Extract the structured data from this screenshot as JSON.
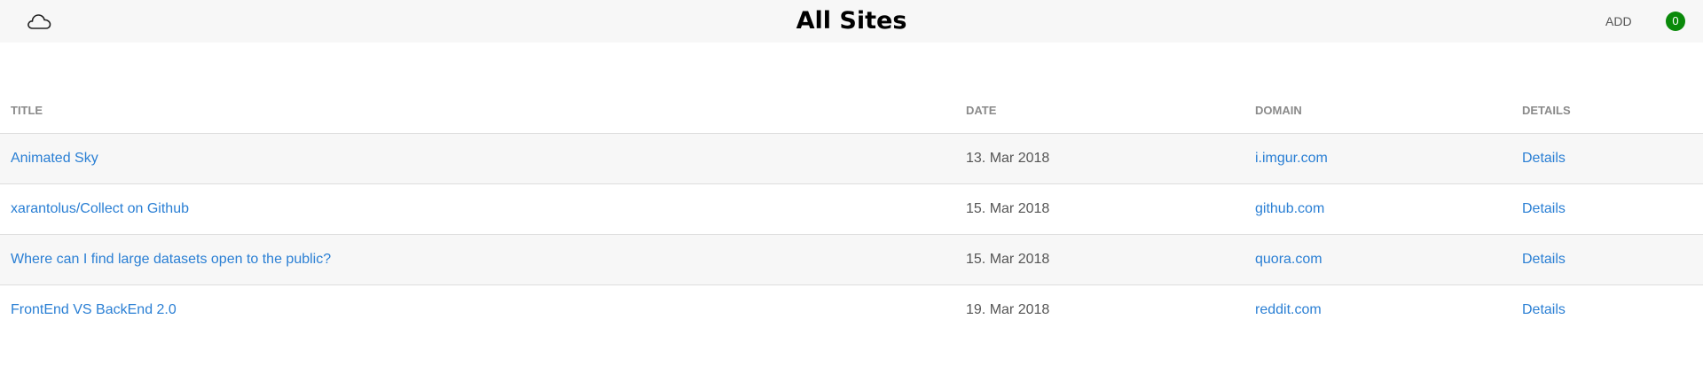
{
  "header": {
    "logo_icon": "cloud-icon",
    "title": "All Sites",
    "add_label": "ADD",
    "badge_count": "0",
    "badge_color": "#0a8a0a"
  },
  "table": {
    "columns": [
      "TITLE",
      "DATE",
      "DOMAIN",
      "DETAILS"
    ],
    "rows": [
      {
        "title": "Animated Sky",
        "date": "13. Mar 2018",
        "domain": "i.imgur.com",
        "details": "Details"
      },
      {
        "title": "xarantolus/Collect on Github",
        "date": "15. Mar 2018",
        "domain": "github.com",
        "details": "Details"
      },
      {
        "title": "Where can I find large datasets open to the public?",
        "date": "15. Mar 2018",
        "domain": "quora.com",
        "details": "Details"
      },
      {
        "title": "FrontEnd VS BackEnd 2.0",
        "date": "19. Mar 2018",
        "domain": "reddit.com",
        "details": "Details"
      }
    ]
  },
  "colors": {
    "link": "#2a7fd4",
    "header_bg": "#f7f7f7",
    "stripe": "#f7f7f7"
  }
}
